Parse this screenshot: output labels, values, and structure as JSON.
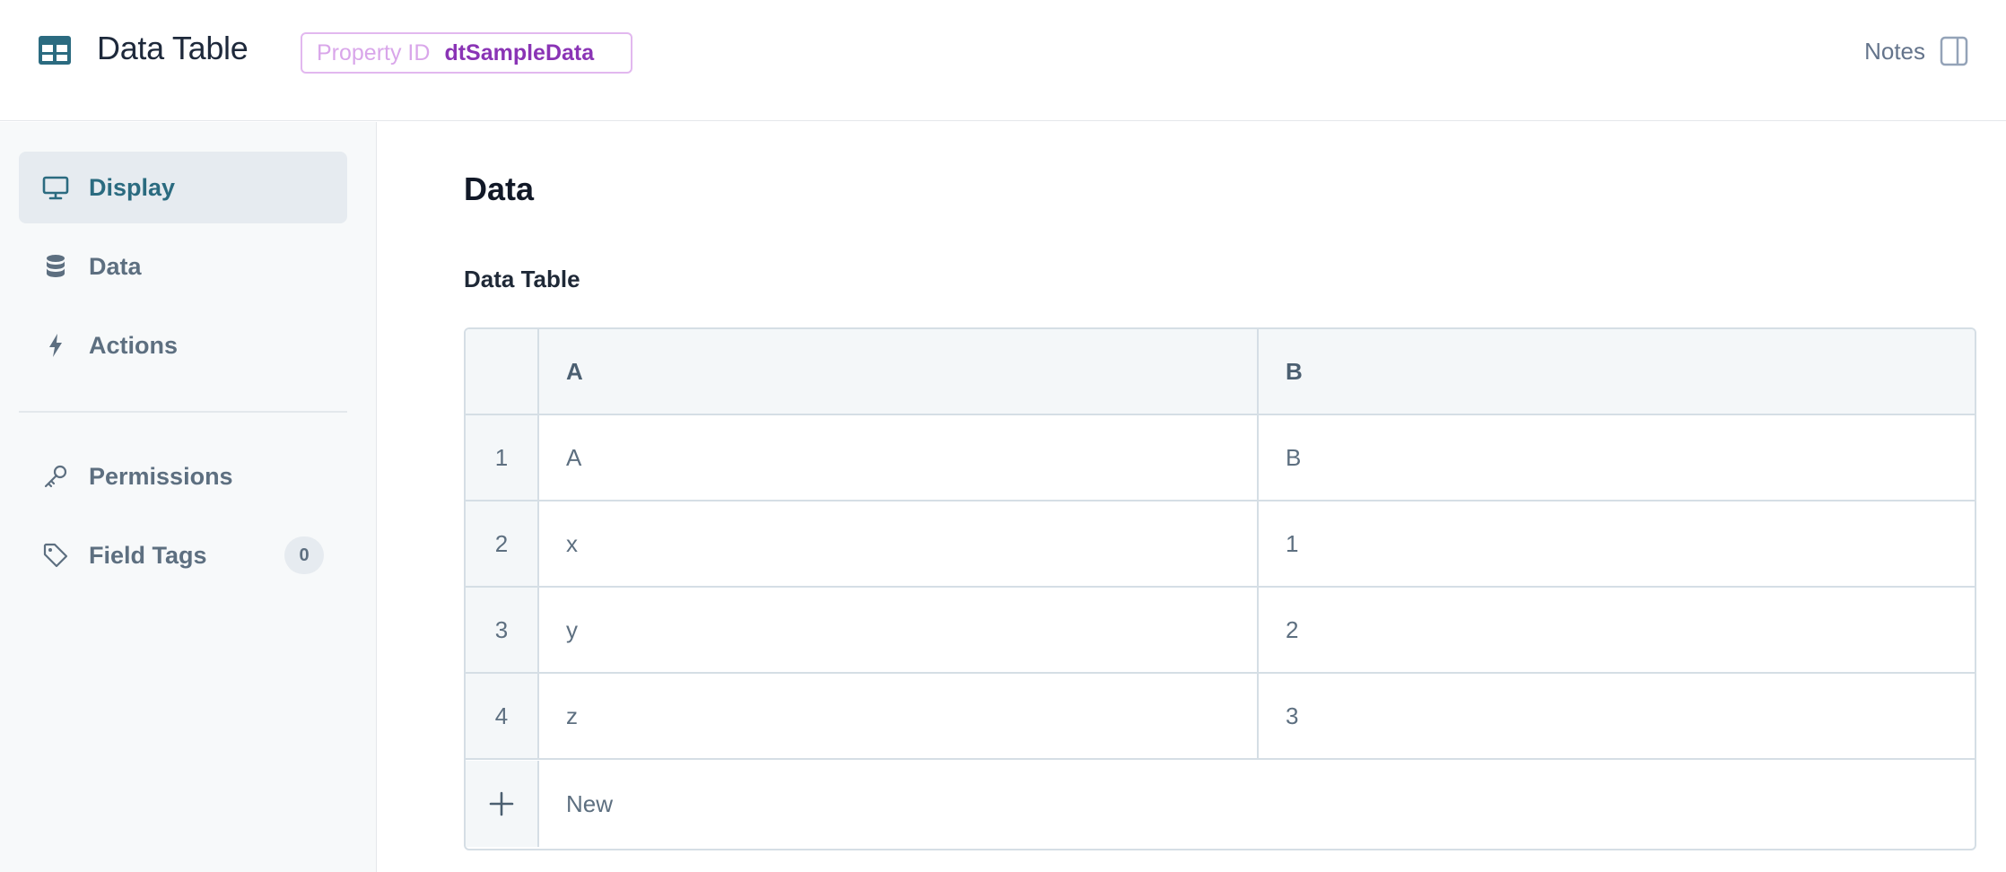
{
  "header": {
    "title": "Data Table",
    "property_id_label": "Property ID",
    "property_id_value": "dtSampleData",
    "notes_label": "Notes",
    "app_icon": "table-icon"
  },
  "sidebar": {
    "items": [
      {
        "label": "Display",
        "icon": "monitor-icon",
        "active": true
      },
      {
        "label": "Data",
        "icon": "database-icon",
        "active": false
      },
      {
        "label": "Actions",
        "icon": "bolt-icon",
        "active": false
      },
      {
        "label": "Permissions",
        "icon": "key-icon",
        "active": false
      },
      {
        "label": "Field Tags",
        "icon": "tag-icon",
        "active": false,
        "badge": "0"
      }
    ]
  },
  "main": {
    "section_title": "Data",
    "field_label": "Data Table",
    "table": {
      "columns": [
        "A",
        "B"
      ],
      "rows": [
        {
          "index": "1",
          "cells": [
            "A",
            "B"
          ]
        },
        {
          "index": "2",
          "cells": [
            "x",
            "1"
          ]
        },
        {
          "index": "3",
          "cells": [
            "y",
            "2"
          ]
        },
        {
          "index": "4",
          "cells": [
            "z",
            "3"
          ]
        }
      ],
      "new_row_label": "New"
    }
  },
  "colors": {
    "accent": "#2b6b80",
    "badge_border": "#e2b8ef",
    "badge_value": "#8a34b5",
    "sidebar_bg": "#f7f9fa"
  }
}
